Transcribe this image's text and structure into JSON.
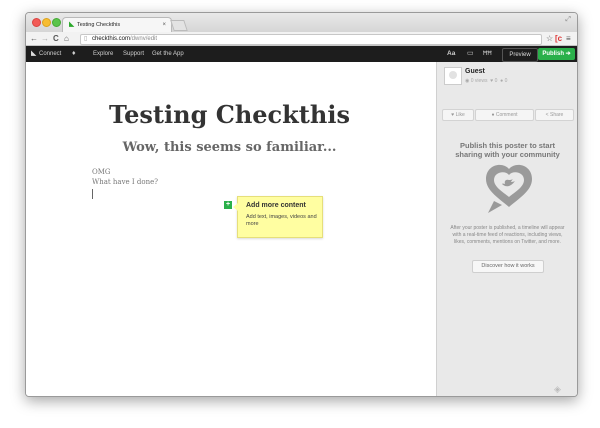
{
  "browser": {
    "tab_title": "Testing Checkthis",
    "tab_close": "×",
    "url_domain": "checkthis.com",
    "url_path": "/dwnv/edit",
    "nav": {
      "back": "←",
      "forward": "→",
      "reload": "C",
      "home": "⌂"
    },
    "icons": {
      "star": "☆",
      "key": "⌐",
      "menu": "≡"
    }
  },
  "app_nav": {
    "connect": "Connect",
    "explore": "Explore",
    "support": "Support",
    "get_app": "Get the App",
    "font_icon": "Aa",
    "image_icon": "▭",
    "layout_icon": "ĦĦ",
    "preview": "Preview",
    "publish": "Publish ➔"
  },
  "editor": {
    "title": "Testing Checkthis",
    "subtitle": "Wow, this seems so familiar...",
    "line1": "OMG",
    "line2": "What have I done?",
    "add_icon": "+",
    "tooltip_title": "Add more content",
    "tooltip_body": "Add text, images, videos and more"
  },
  "sidebar": {
    "user": "Guest",
    "views": "0 views",
    "likes": "0",
    "comments": "0",
    "like": "♥ Like",
    "comment": "● Comment",
    "share": "< Share",
    "publish_heading": "Publish this poster to start sharing with your community",
    "publish_body": "After your poster is published, a timeline will appear with a real-time feed of reactions, including views, likes, comments, mentions on Twitter, and more.",
    "discover": "Discover how it works"
  },
  "colors": {
    "accent_green": "#2ab04a",
    "nav_dark": "#1d1d1d",
    "tooltip_yellow": "#fffea1",
    "sidebar_bg": "#e9e9e9"
  }
}
